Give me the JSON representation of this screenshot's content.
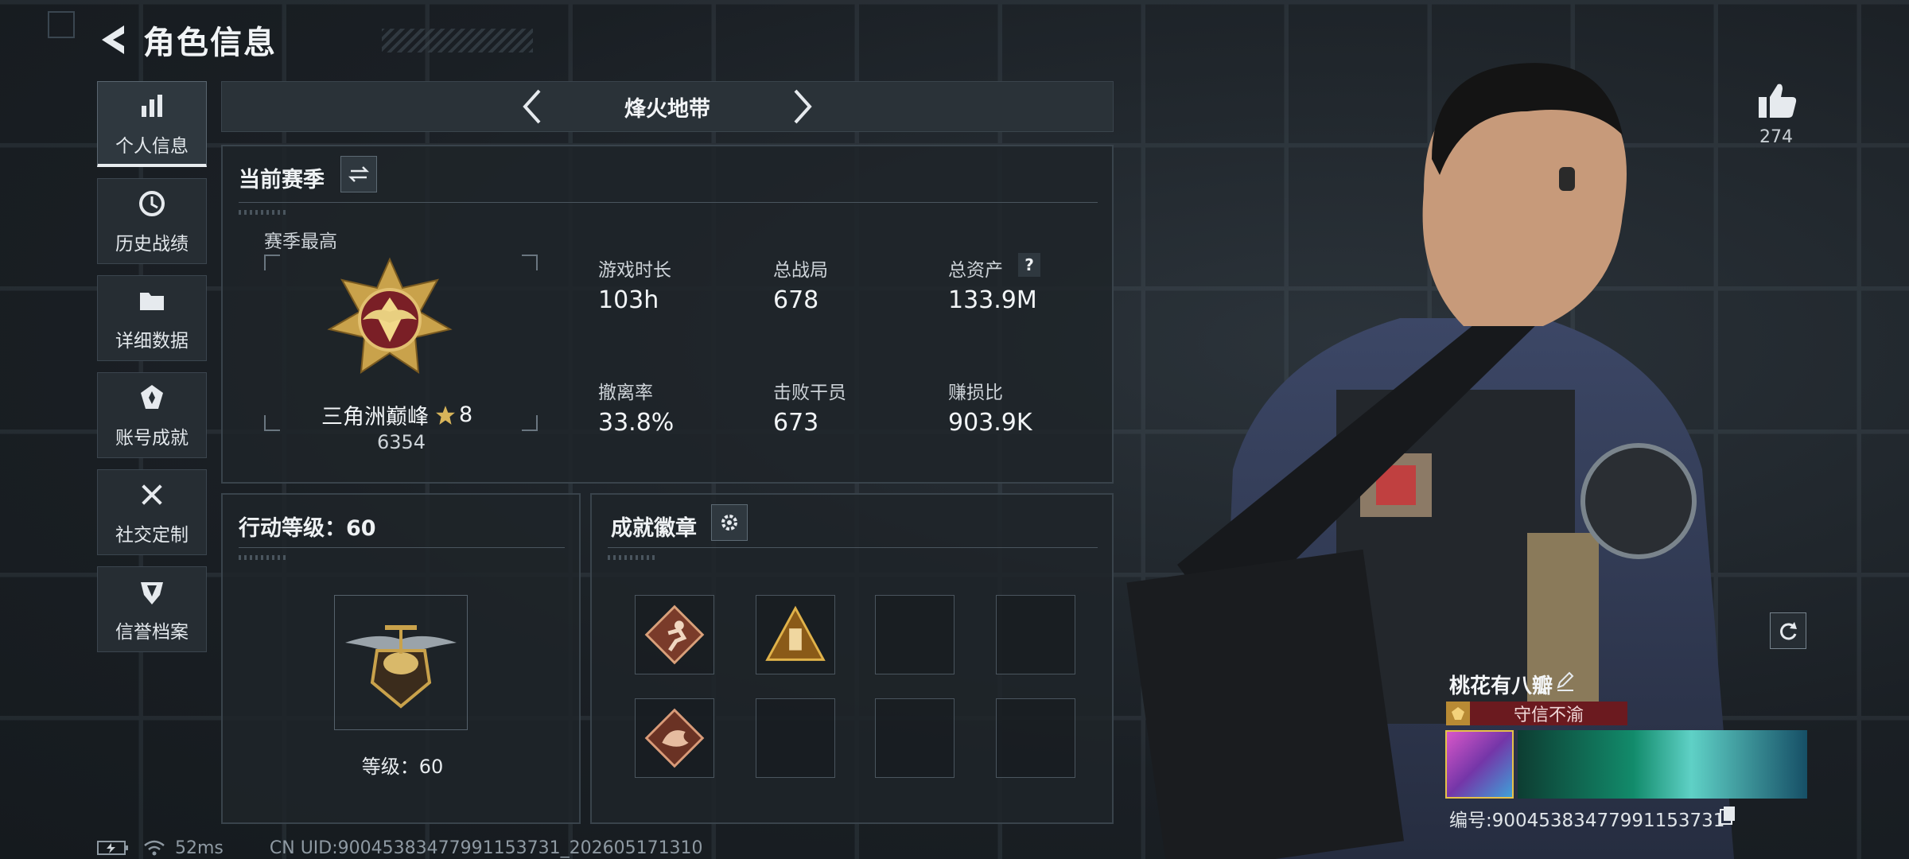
{
  "header": {
    "title": "角色信息"
  },
  "sidebar": {
    "items": [
      {
        "label": "个人信息",
        "icon": "bar-chart-icon",
        "active": true
      },
      {
        "label": "历史战绩",
        "icon": "history-icon",
        "active": false
      },
      {
        "label": "详细数据",
        "icon": "folder-icon",
        "active": false
      },
      {
        "label": "账号成就",
        "icon": "achievement-icon",
        "active": false
      },
      {
        "label": "社交定制",
        "icon": "tools-icon",
        "active": false
      },
      {
        "label": "信誉档案",
        "icon": "reputation-icon",
        "active": false
      }
    ]
  },
  "mode": {
    "title": "烽火地带"
  },
  "season": {
    "title": "当前赛季",
    "best_label": "赛季最高",
    "rank_name": "三角洲巅峰",
    "rank_stars": "8",
    "rank_score": "6354",
    "stats": [
      {
        "label": "游戏时长",
        "value": "103h"
      },
      {
        "label": "总战局",
        "value": "678"
      },
      {
        "label": "总资产",
        "value": "133.9M"
      },
      {
        "label": "撤离率",
        "value": "33.8%"
      },
      {
        "label": "击败干员",
        "value": "673"
      },
      {
        "label": "赚损比",
        "value": "903.9K"
      }
    ],
    "help_glyph": "?"
  },
  "level_panel": {
    "title": "行动等级：60",
    "level_text": "等级：60"
  },
  "badges_panel": {
    "title": "成就徽章"
  },
  "character": {
    "likes": "274",
    "name": "桃花有八瓣",
    "title_badge": "守信不渝",
    "uid_line": "编号:9004538347799115373​1"
  },
  "status": {
    "ping": "52ms",
    "uid": "CN UID:9004538347799115373​1_202605171310"
  },
  "colors": {
    "background": "#1d2329",
    "panel_border": "#39434b",
    "title_badge": "#6b1a1f",
    "gold": "#c9a24b"
  }
}
